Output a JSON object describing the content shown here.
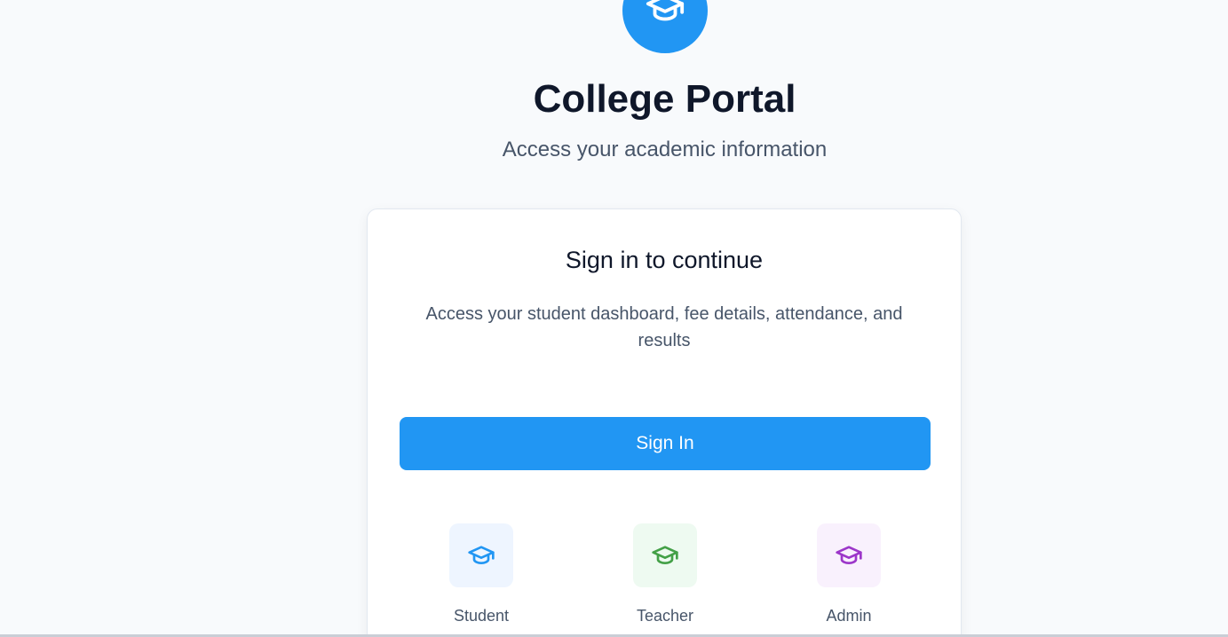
{
  "header": {
    "logo_icon": "graduation-cap-icon",
    "title": "College Portal",
    "subtitle": "Access your academic information"
  },
  "card": {
    "title": "Sign in to continue",
    "description": "Access your student dashboard, fee details, attendance, and results",
    "signin_label": "Sign In"
  },
  "roles": [
    {
      "label": "Student",
      "icon": "graduation-cap-icon",
      "color": "#2196f3",
      "bg": "#eef5ff"
    },
    {
      "label": "Teacher",
      "icon": "graduation-cap-icon",
      "color": "#43a047",
      "bg": "#eefaf1"
    },
    {
      "label": "Admin",
      "icon": "graduation-cap-icon",
      "color": "#9c36c9",
      "bg": "#f9f1fd"
    }
  ],
  "colors": {
    "accent": "#2196f3",
    "background": "#f8fafc"
  }
}
